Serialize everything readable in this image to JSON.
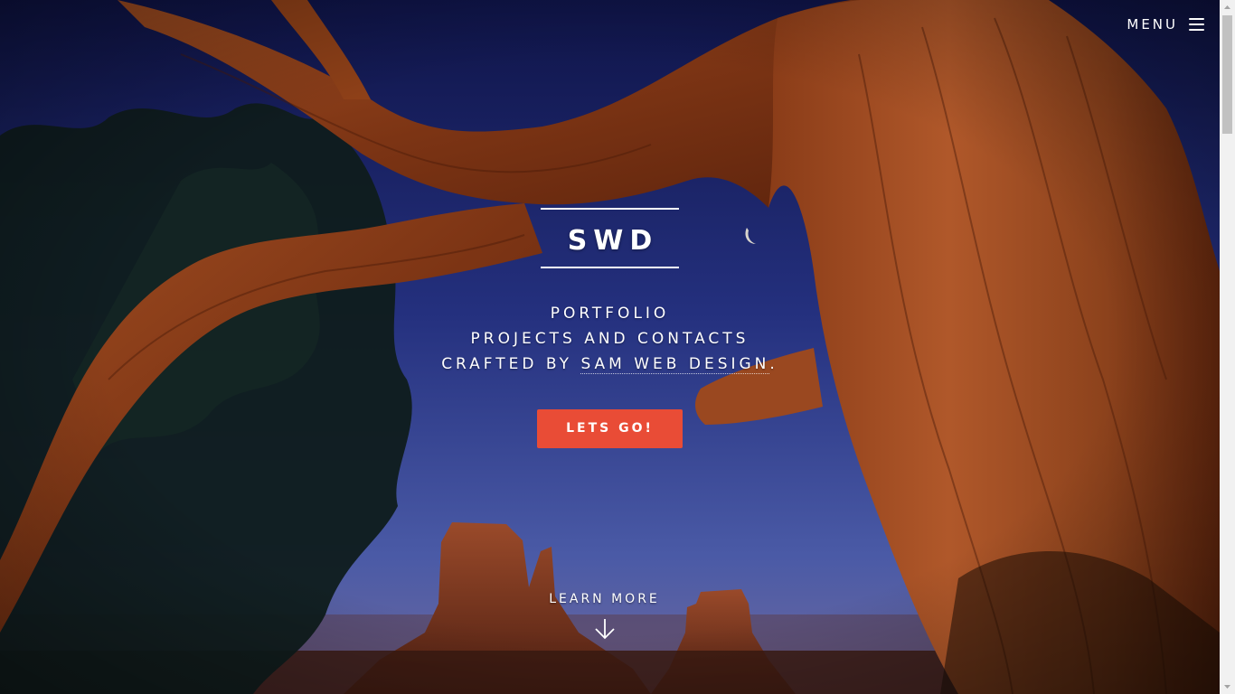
{
  "header": {
    "menu_label": "MENU",
    "menu_icon": "hamburger-icon"
  },
  "banner": {
    "title": "SWD",
    "tagline_line1": "PORTFOLIO",
    "tagline_line2": "PROJECTS AND CONTACTS",
    "tagline_line3_prefix": "CRAFTED BY ",
    "tagline_author_link": "SAM WEB DESIGN",
    "tagline_line3_suffix": ".",
    "cta_label": "LETS GO!"
  },
  "learn_more": {
    "label": "LEARN MORE",
    "icon": "arrow-down-icon"
  },
  "colors": {
    "accent": "#e94c36",
    "sky_top": "#141a55",
    "sky_bottom": "#3a4a9a",
    "wood": "#8a3f1c"
  }
}
